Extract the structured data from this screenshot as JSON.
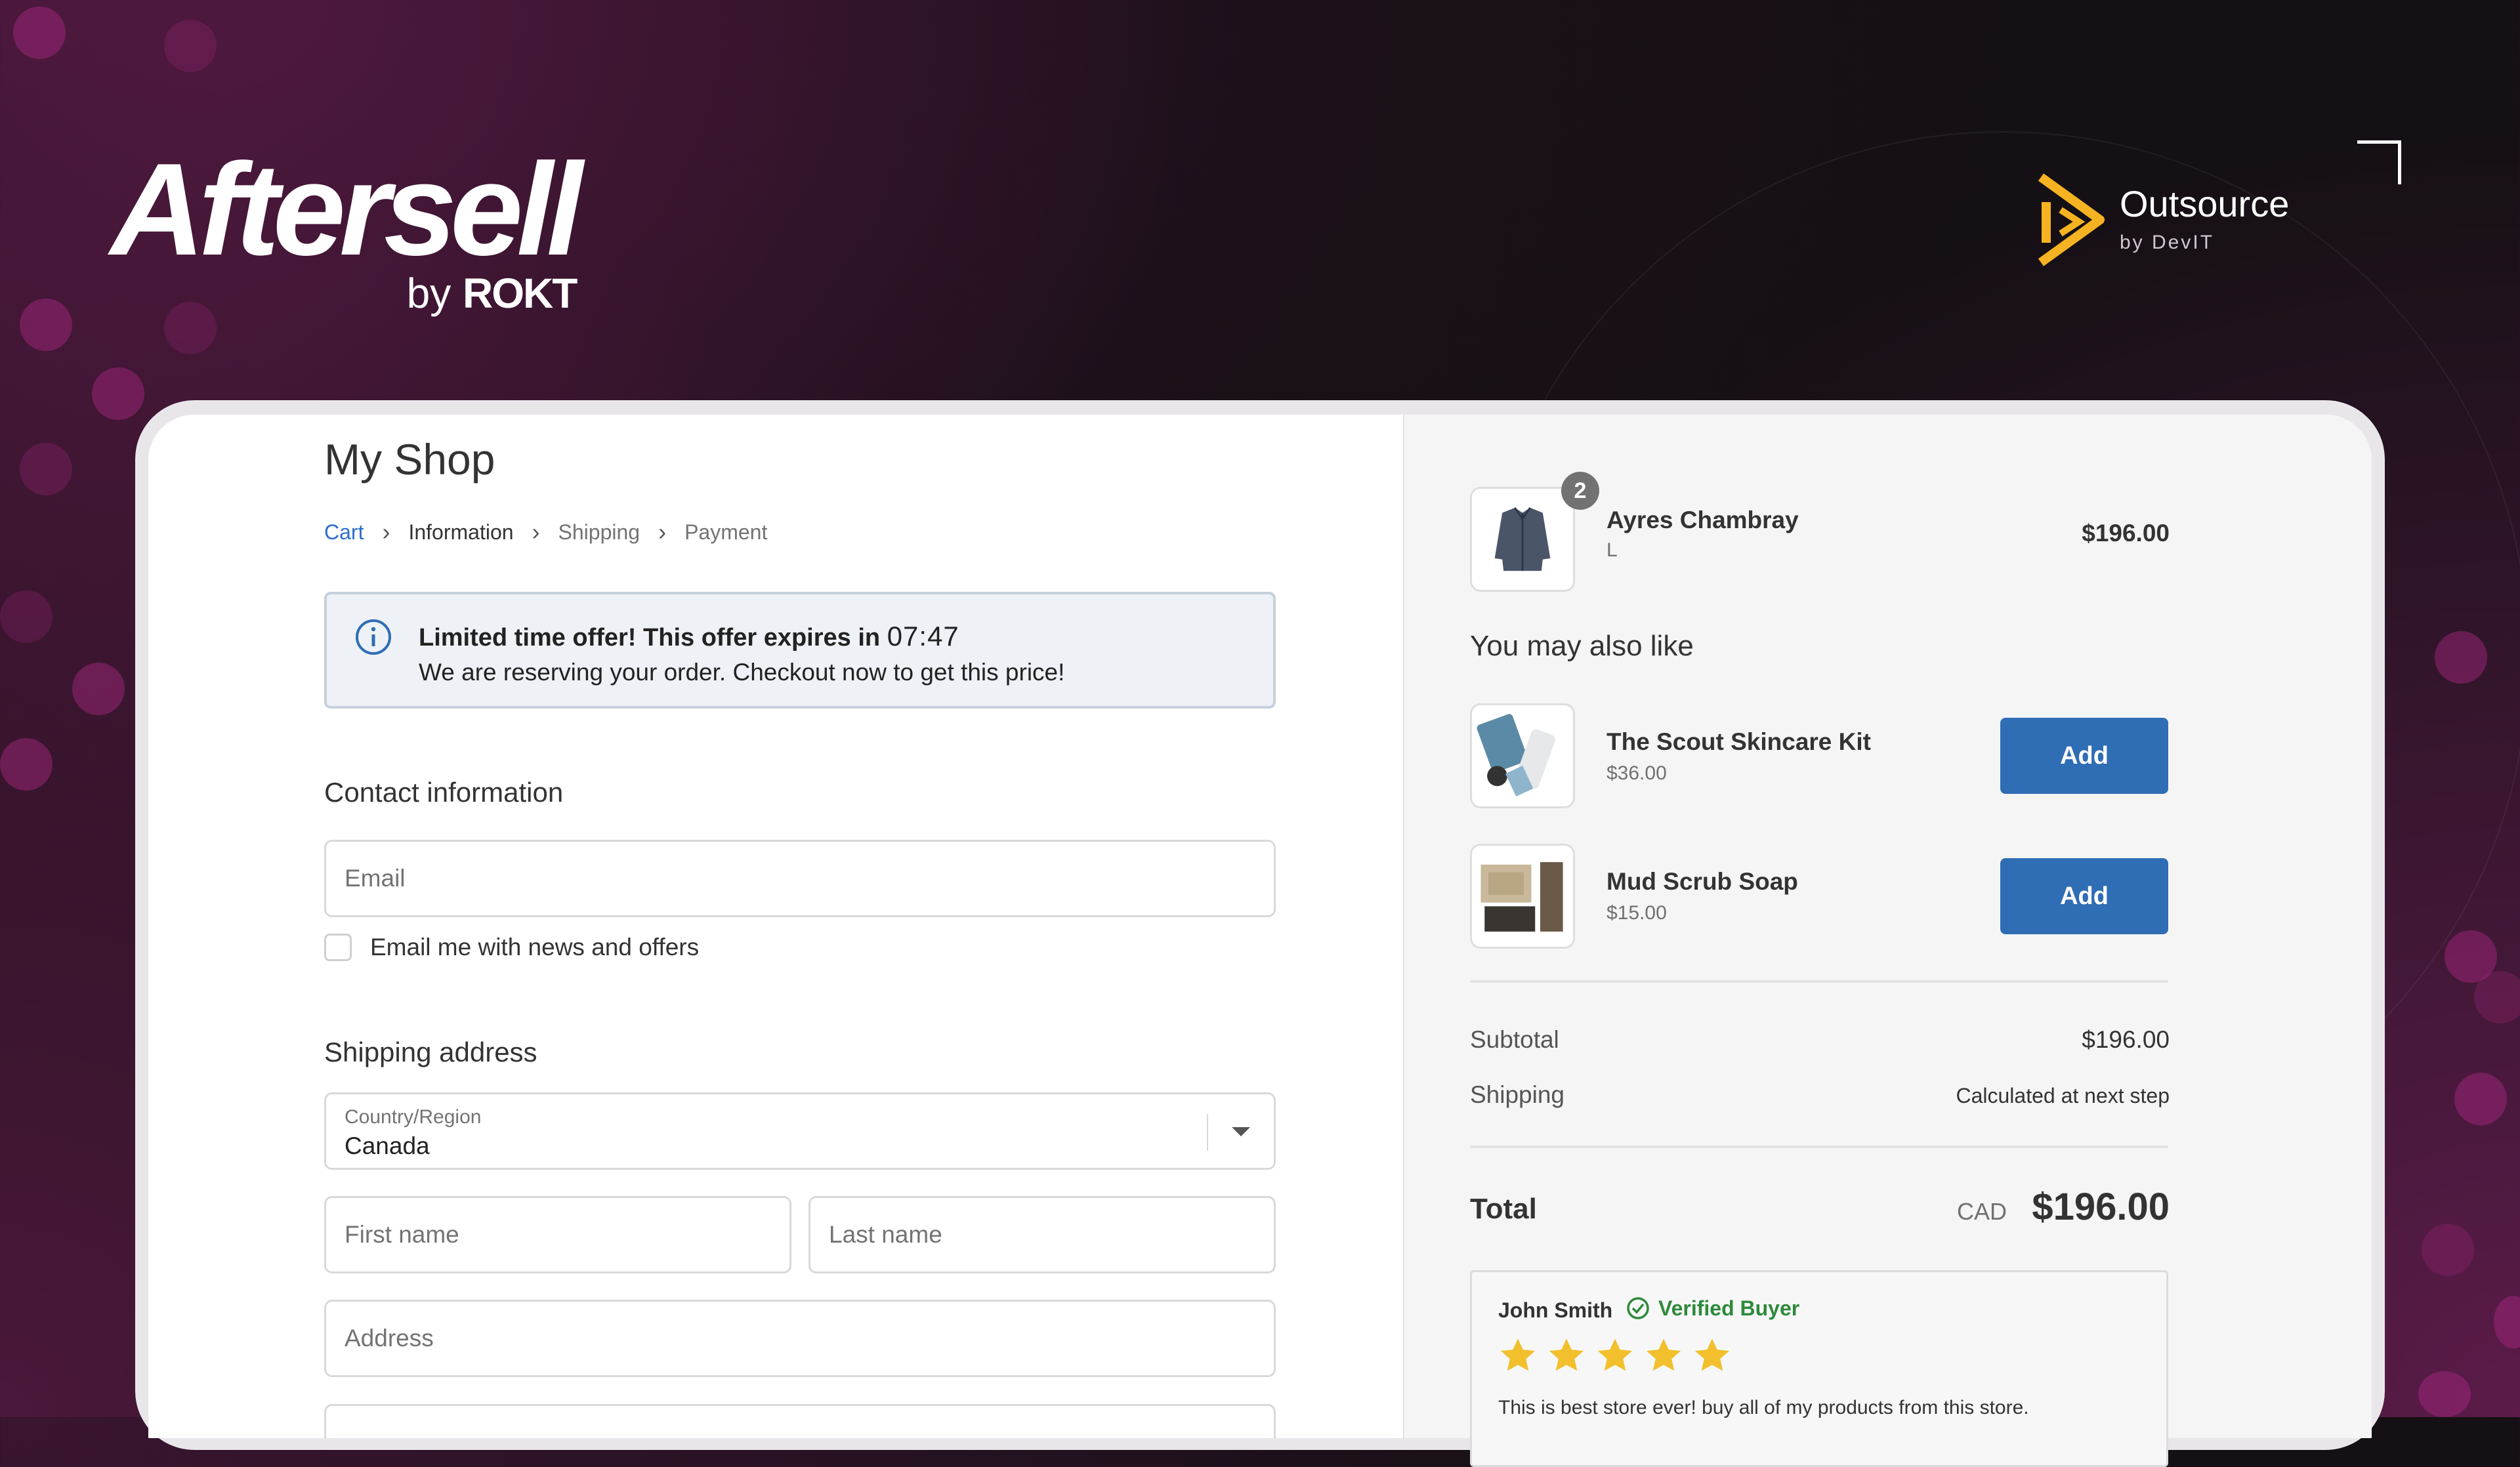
{
  "branding": {
    "logo_text": "Aftersell",
    "logo_by": "by",
    "logo_brand": "ROKT",
    "partner_name": "Outsource",
    "partner_by": "by DevIT"
  },
  "colors": {
    "accent_button": "#2f6db4",
    "breadcrumb_link": "#2c6ecb",
    "verified_green": "#2d8a3a",
    "star_yellow": "#f2c02c",
    "partner_logo": "#f5b322"
  },
  "checkout": {
    "shop_title": "My Shop",
    "breadcrumb": [
      "Cart",
      "Information",
      "Shipping",
      "Payment"
    ],
    "alert": {
      "title": "Limited time offer! This offer expires in",
      "timer": "07:47",
      "body": "We are reserving your order. Checkout now to get this price!",
      "icon": "info-icon"
    },
    "contact": {
      "heading": "Contact information",
      "email_placeholder": "Email",
      "news_checkbox_label": "Email me with news and offers"
    },
    "shipping": {
      "heading": "Shipping address",
      "country_label": "Country/Region",
      "country_value": "Canada",
      "first_name_placeholder": "First name",
      "last_name_placeholder": "Last name",
      "address_placeholder": "Address"
    }
  },
  "summary": {
    "item": {
      "name": "Ayres Chambray",
      "variant": "L",
      "quantity": "2",
      "price": "$196.00"
    },
    "upsell_heading": "You may also like",
    "upsells": [
      {
        "name": "The Scout Skincare Kit",
        "price": "$36.00",
        "button": "Add"
      },
      {
        "name": "Mud Scrub Soap",
        "price": "$15.00",
        "button": "Add"
      }
    ],
    "subtotal_label": "Subtotal",
    "subtotal_value": "$196.00",
    "shipping_label": "Shipping",
    "shipping_value": "Calculated at next step",
    "total_label": "Total",
    "total_currency": "CAD",
    "total_value": "$196.00",
    "review": {
      "reviewer": "John Smith",
      "verified": "Verified Buyer",
      "stars": 5,
      "text": "This is best store ever! buy all of my products from this store."
    }
  }
}
